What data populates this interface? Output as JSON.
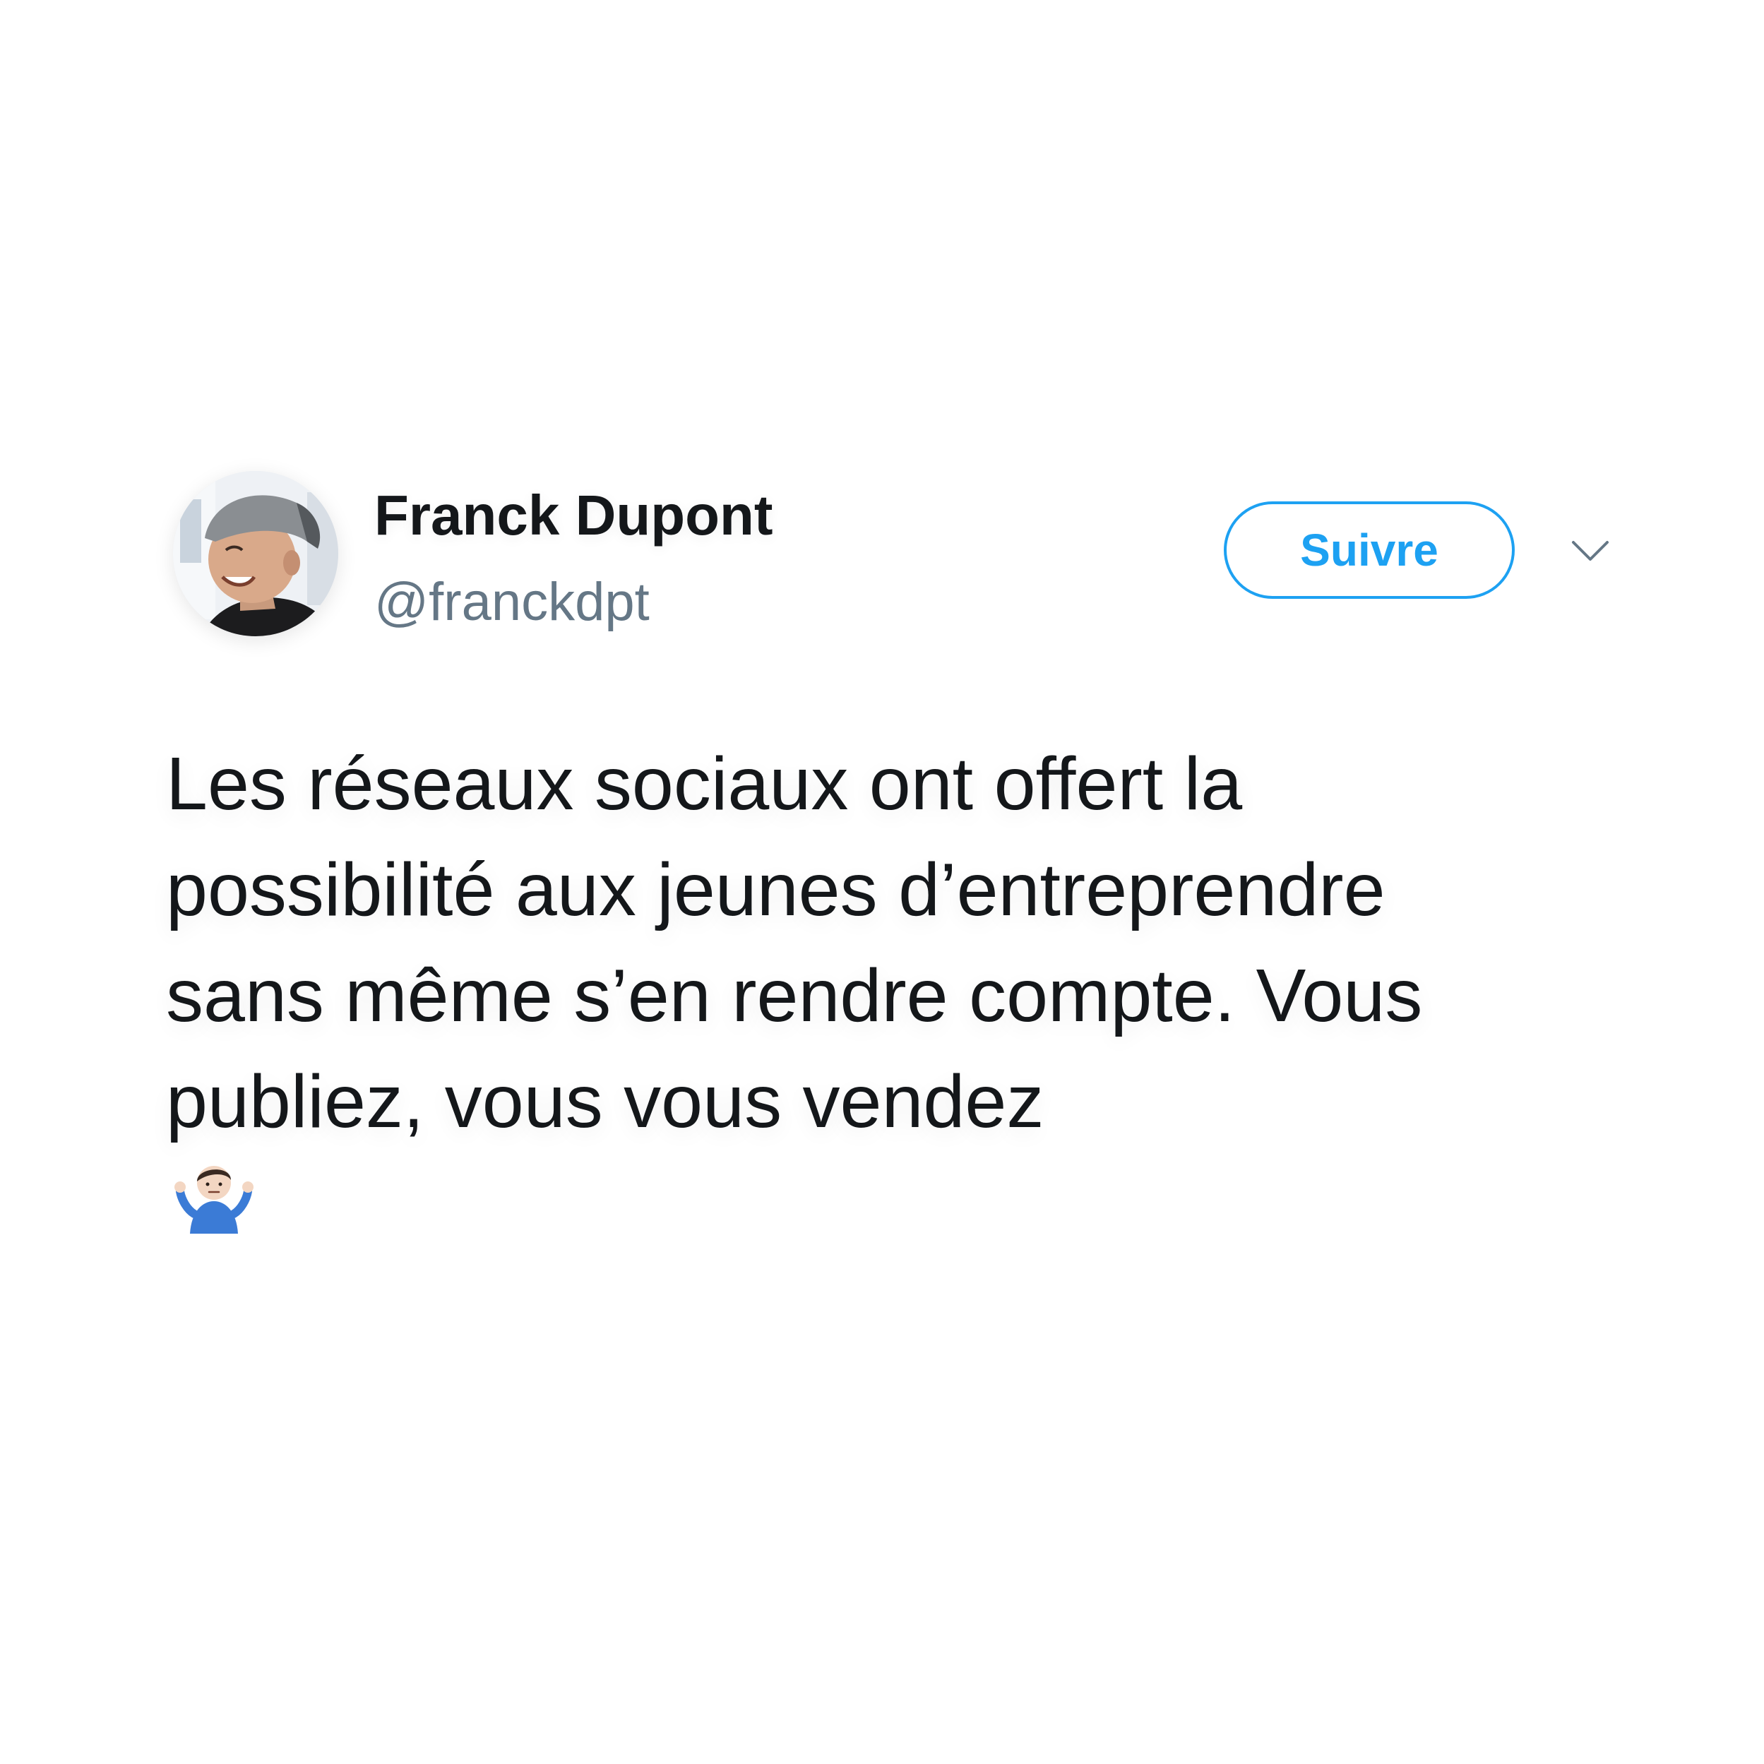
{
  "user": {
    "display_name": "Franck Dupont",
    "handle": "@franckdpt",
    "avatar_icon": "profile-photo"
  },
  "actions": {
    "follow_label": "Suivre",
    "menu_icon": "chevron-down-icon"
  },
  "tweet": {
    "lines": [
      "Les réseaux sociaux ont offert la",
      "possibilité aux jeunes d’entreprendre",
      "sans même s’en rendre compte. Vous",
      "publiez, vous vous vendez"
    ],
    "emoji": "person-shrugging-emoji"
  },
  "colors": {
    "accent": "#1da1f2",
    "text": "#14171a",
    "secondary": "#657786"
  }
}
